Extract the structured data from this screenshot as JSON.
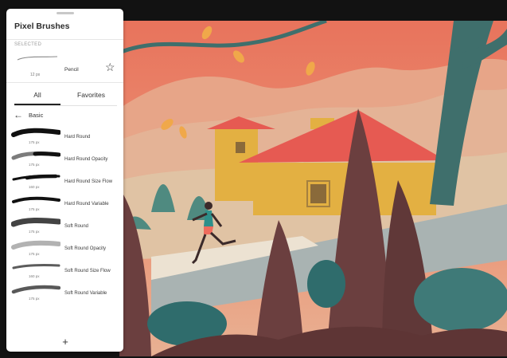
{
  "panel": {
    "title": "Pixel Brushes",
    "selected_label": "SELECTED",
    "selected": {
      "name": "Pencil",
      "size": "12 px"
    },
    "favorite_icon": "star-outline-icon"
  },
  "tabs": [
    {
      "label": "All",
      "active": true
    },
    {
      "label": "Favorites",
      "active": false
    }
  ],
  "category": {
    "back_icon": "arrow-left-icon",
    "label": "Basic"
  },
  "brushes": [
    {
      "name": "Hard Round",
      "size": "175 px"
    },
    {
      "name": "Hard Round Opacity",
      "size": "175 px"
    },
    {
      "name": "Hard Round Size Flow",
      "size": "160 px"
    },
    {
      "name": "Hard Round Variable",
      "size": "175 px"
    },
    {
      "name": "Soft Round",
      "size": "175 px"
    },
    {
      "name": "Soft Round Opacity",
      "size": "175 px"
    },
    {
      "name": "Soft Round Size Flow",
      "size": "160 px"
    },
    {
      "name": "Soft Round Variable",
      "size": "175 px"
    }
  ],
  "add_icon": "plus-icon",
  "colors": {
    "sky": "#e9745e",
    "hills": "#e6b59a",
    "house_wall": "#e3b042",
    "roof": "#e65a52",
    "trees_dark": "#6b3f3f",
    "teal": "#3f7a78"
  }
}
